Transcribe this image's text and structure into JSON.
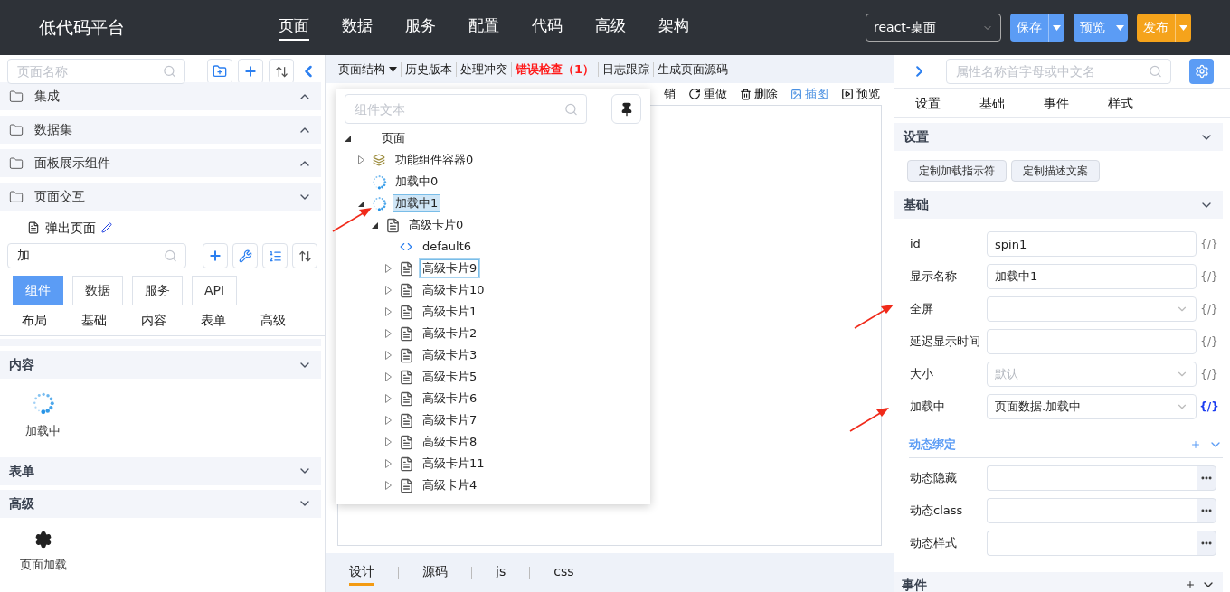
{
  "header": {
    "title": "低代码平台",
    "nav": [
      {
        "label": "页面",
        "selected": true
      },
      {
        "label": "数据",
        "selected": false
      },
      {
        "label": "服务",
        "selected": false
      },
      {
        "label": "配置",
        "selected": false
      },
      {
        "label": "代码",
        "selected": false
      },
      {
        "label": "高级",
        "selected": false
      },
      {
        "label": "架构",
        "selected": false
      }
    ],
    "platform_select": {
      "value": "react-桌面"
    },
    "buttons": [
      {
        "label": "保存",
        "kind": "primary"
      },
      {
        "label": "预览",
        "kind": "primary"
      },
      {
        "label": "发布",
        "kind": "warning"
      }
    ]
  },
  "left_panel": {
    "page_search": {
      "placeholder": "页面名称"
    },
    "folders": [
      {
        "label": "集成",
        "expanded": false
      },
      {
        "label": "数据集",
        "expanded": false
      },
      {
        "label": "面板展示组件",
        "expanded": false
      },
      {
        "label": "页面交互",
        "expanded": true,
        "pages": [
          {
            "label": "弹出页面"
          }
        ]
      }
    ],
    "component_search": {
      "value": "加"
    },
    "tabs": [
      {
        "label": "组件",
        "selected": true
      },
      {
        "label": "数据",
        "selected": false
      },
      {
        "label": "服务",
        "selected": false
      },
      {
        "label": "API",
        "selected": false
      }
    ],
    "categories": [
      {
        "label": "布局"
      },
      {
        "label": "基础"
      },
      {
        "label": "内容"
      },
      {
        "label": "表单"
      },
      {
        "label": "高级"
      }
    ],
    "groups": [
      {
        "label": "内容",
        "expanded": true,
        "items": [
          {
            "label": "加载中",
            "kind": "spinner"
          }
        ]
      },
      {
        "label": "表单",
        "expanded": true
      },
      {
        "label": "高级",
        "expanded": true,
        "items": [
          {
            "label": "页面加载",
            "kind": "gear"
          }
        ]
      }
    ]
  },
  "editor": {
    "menu": [
      {
        "label": "页面结构",
        "kind": "dropdown"
      },
      {
        "label": "历史版本",
        "kind": "plain"
      },
      {
        "label": "处理冲突",
        "kind": "plain"
      },
      {
        "label": "错误检查（1）",
        "kind": "error"
      },
      {
        "label": "日志跟踪",
        "kind": "plain"
      },
      {
        "label": "生成页面源码",
        "kind": "plain"
      }
    ],
    "tools": [
      {
        "label": "销",
        "kind": "partial"
      },
      {
        "label": "重做",
        "kind": "redo"
      },
      {
        "label": "删除",
        "kind": "delete"
      },
      {
        "label": "插图",
        "kind": "image"
      },
      {
        "label": "预览",
        "kind": "preview"
      }
    ],
    "structure_popup": {
      "search": {
        "placeholder": "组件文本"
      },
      "tree": [
        {
          "label": "页面",
          "expanded": true,
          "selected": false,
          "hovered": false,
          "children": [
            {
              "label": "功能组件容器0",
              "kind": "container",
              "expanded": false,
              "selected": false,
              "hovered": false
            },
            {
              "label": "加载中0",
              "kind": "spinner",
              "selected": false,
              "hovered": false
            },
            {
              "label": "加载中1",
              "kind": "spinner",
              "expanded": true,
              "selected": true,
              "hovered": false,
              "children": [
                {
                  "label": "高级卡片0",
                  "kind": "card",
                  "expanded": true,
                  "selected": false,
                  "hovered": false,
                  "children": [
                    {
                      "label": "default6",
                      "kind": "code",
                      "selected": false,
                      "hovered": false
                    },
                    {
                      "label": "高级卡片9",
                      "kind": "card",
                      "expanded": false,
                      "selected": false,
                      "hovered": true
                    },
                    {
                      "label": "高级卡片10",
                      "kind": "card",
                      "expanded": false,
                      "selected": false,
                      "hovered": false
                    },
                    {
                      "label": "高级卡片1",
                      "kind": "card",
                      "expanded": false,
                      "selected": false,
                      "hovered": false
                    },
                    {
                      "label": "高级卡片2",
                      "kind": "card",
                      "expanded": false,
                      "selected": false,
                      "hovered": false
                    },
                    {
                      "label": "高级卡片3",
                      "kind": "card",
                      "expanded": false,
                      "selected": false,
                      "hovered": false
                    },
                    {
                      "label": "高级卡片5",
                      "kind": "card",
                      "expanded": false,
                      "selected": false,
                      "hovered": false
                    },
                    {
                      "label": "高级卡片6",
                      "kind": "card",
                      "expanded": false,
                      "selected": false,
                      "hovered": false
                    },
                    {
                      "label": "高级卡片7",
                      "kind": "card",
                      "expanded": false,
                      "selected": false,
                      "hovered": false
                    },
                    {
                      "label": "高级卡片8",
                      "kind": "card",
                      "expanded": false,
                      "selected": false,
                      "hovered": false
                    },
                    {
                      "label": "高级卡片11",
                      "kind": "card",
                      "expanded": false,
                      "selected": false,
                      "hovered": false
                    },
                    {
                      "label": "高级卡片4",
                      "kind": "card",
                      "expanded": false,
                      "selected": false,
                      "hovered": false
                    }
                  ]
                }
              ]
            }
          ]
        }
      ]
    },
    "bottom_tabs": [
      {
        "label": "设计",
        "selected": true
      },
      {
        "label": "源码",
        "selected": false
      },
      {
        "label": "js",
        "selected": false
      },
      {
        "label": "css",
        "selected": false
      }
    ]
  },
  "right_panel": {
    "search": {
      "placeholder": "属性名称首字母或中文名"
    },
    "tabs": [
      {
        "label": "设置"
      },
      {
        "label": "基础"
      },
      {
        "label": "事件"
      },
      {
        "label": "样式"
      }
    ],
    "settings_section": {
      "title": "设置",
      "expanded": true,
      "buttons": [
        "定制加载指示符",
        "定制描述文案"
      ]
    },
    "basic_section": {
      "title": "基础",
      "expanded": true,
      "fields": [
        {
          "label": "id",
          "kind": "text",
          "value": "spin1",
          "binding": "{/}",
          "bound": false
        },
        {
          "label": "显示名称",
          "kind": "text",
          "value": "加载中1",
          "binding": "{/}",
          "bound": false
        },
        {
          "label": "全屏",
          "kind": "select",
          "binding": "{/}",
          "bound": false
        },
        {
          "label": "延迟显示时间",
          "kind": "text",
          "binding": "{/}",
          "bound": false
        },
        {
          "label": "大小",
          "kind": "select",
          "placeholder": "默认",
          "binding": "{/}",
          "bound": false
        },
        {
          "label": "加载中",
          "kind": "select",
          "value": "页面数据.加载中",
          "binding": "{/}",
          "bound": true
        }
      ]
    },
    "dynamic_binding": {
      "title": "动态绑定",
      "fields": [
        {
          "label": "动态隐藏"
        },
        {
          "label": "动态class"
        },
        {
          "label": "动态样式"
        }
      ]
    },
    "events_section": {
      "title": "事件"
    }
  }
}
